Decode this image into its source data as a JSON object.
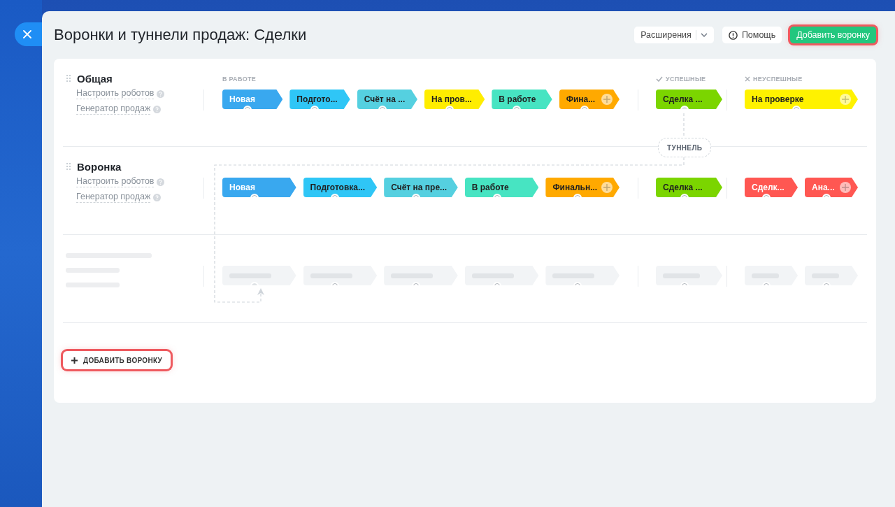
{
  "header": {
    "title": "Воронки и туннели продаж: Сделки",
    "buttons": [
      {
        "kind": "split",
        "label": "Расширения",
        "highlighted": false
      },
      {
        "kind": "help",
        "label": "Помощь",
        "highlighted": false
      },
      {
        "kind": "primary",
        "label": "Добавить воронку",
        "highlighted": true
      }
    ]
  },
  "funnels": [
    {
      "kind": "funnel",
      "name": "Общая",
      "links": [
        "Настроить роботов",
        "Генератор продаж"
      ],
      "groups": [
        {
          "kind": "progress",
          "label": "В РАБОТЕ",
          "add_button": true,
          "stages": [
            {
              "name": "Новая",
              "color": "#39a8ef",
              "linked": false
            },
            {
              "name": "Подгото...",
              "color": "#2fc6f6",
              "linked": false
            },
            {
              "name": "Счёт на ...",
              "color": "#55d0e0",
              "linked": false
            },
            {
              "name": "На пров...",
              "color": "#ffed00",
              "linked": false
            },
            {
              "name": "В работе",
              "color": "#47e4c2",
              "linked": false
            },
            {
              "name": "Фина...",
              "color": "#ffa900",
              "linked": false
            }
          ]
        },
        {
          "kind": "success",
          "label": "УСПЕШНЫЕ",
          "add_button": false,
          "stages": [
            {
              "name": "Сделка ...",
              "color": "#7bd500",
              "linked": true
            }
          ]
        },
        {
          "kind": "failure",
          "label": "НЕУСПЕШНЫЕ",
          "add_button": true,
          "stages": [
            {
              "name": "На проверке",
              "color": "#fff200",
              "linked": false
            }
          ]
        }
      ]
    },
    {
      "kind": "funnel",
      "name": "Воронка",
      "links": [
        "Настроить роботов",
        "Генератор продаж"
      ],
      "groups": [
        {
          "kind": "progress",
          "add_button": true,
          "stages": [
            {
              "name": "Новая",
              "color": "#39a8ef",
              "linked": false
            },
            {
              "name": "Подготовка...",
              "color": "#2fc6f6",
              "linked": false
            },
            {
              "name": "Счёт на пре...",
              "color": "#55d0e0",
              "linked": false
            },
            {
              "name": "В работе",
              "color": "#47e4c2",
              "linked": false
            },
            {
              "name": "Финальн...",
              "color": "#ffa900",
              "linked": false
            }
          ]
        },
        {
          "kind": "success",
          "add_button": false,
          "stages": [
            {
              "name": "Сделка ...",
              "color": "#7bd500",
              "linked": false
            }
          ]
        },
        {
          "kind": "failure",
          "add_button": true,
          "stages": [
            {
              "name": "Сделк...",
              "color": "#ff5752",
              "linked": false
            },
            {
              "name": "Ана...",
              "color": "#ff5752",
              "linked": false
            }
          ]
        }
      ]
    },
    {
      "kind": "skeleton",
      "groups": [
        {
          "kind": "progress",
          "stages": [
            {
              "linked": true
            },
            {
              "linked": false
            },
            {
              "linked": false
            },
            {
              "linked": false
            },
            {
              "linked": false
            }
          ]
        },
        {
          "kind": "success",
          "stages": [
            {
              "linked": false
            }
          ]
        },
        {
          "kind": "failure",
          "stages": [
            {
              "linked": false
            },
            {
              "linked": false
            }
          ]
        }
      ]
    }
  ],
  "tunnel": {
    "label": "ТУННЕЛЬ"
  },
  "add_funnel": {
    "label": "ДОБАВИТЬ ВОРОНКУ",
    "highlighted": true
  }
}
